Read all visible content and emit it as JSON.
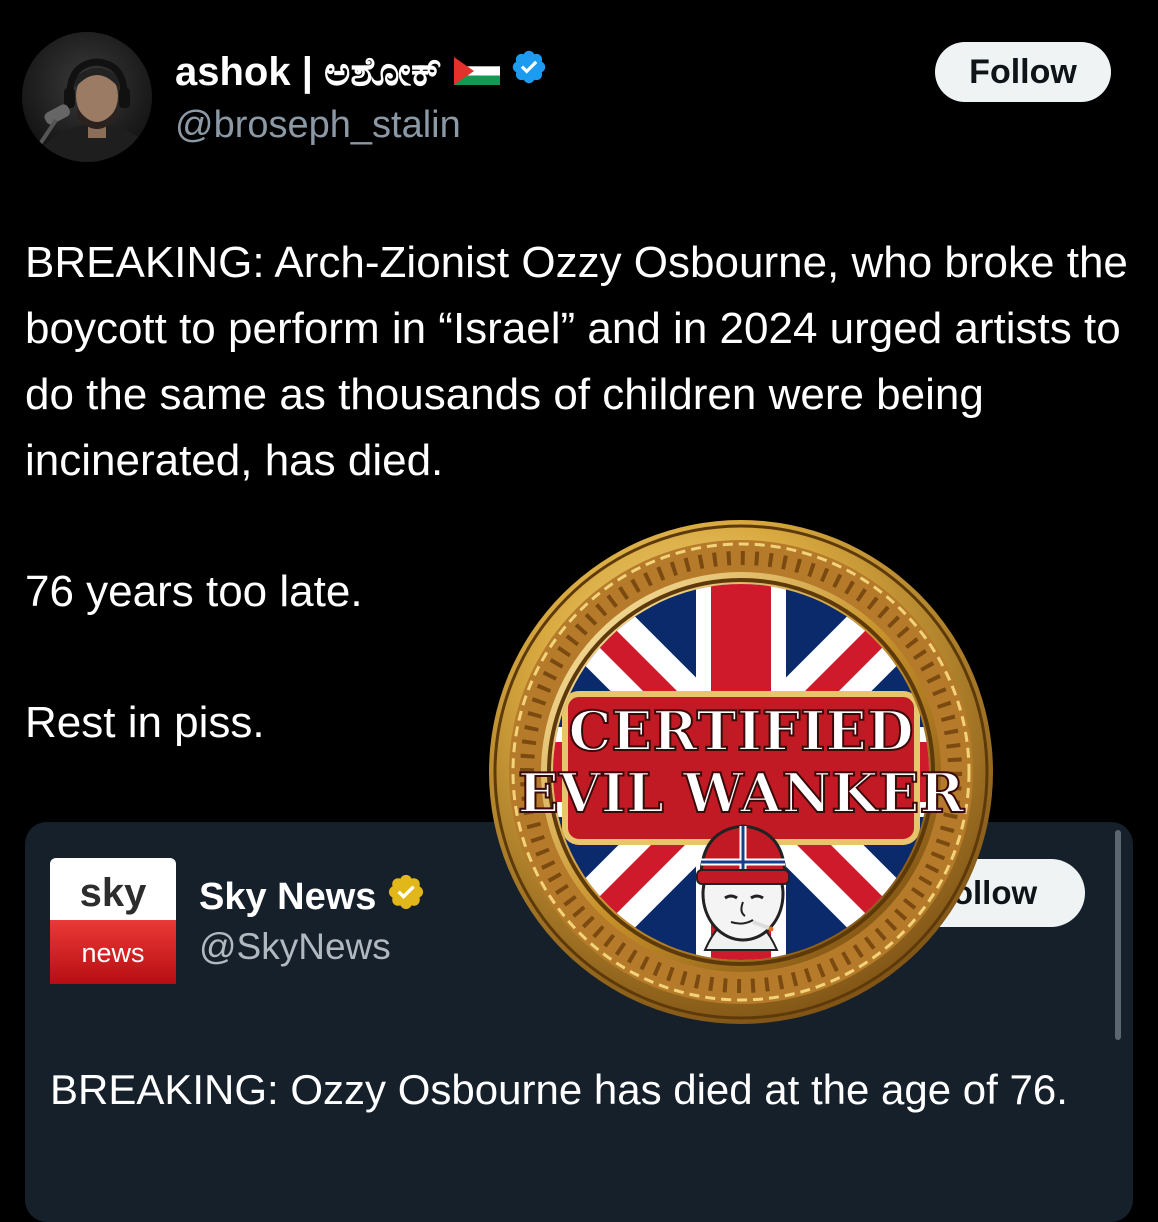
{
  "author": {
    "name": "ashok | ಅಶೋಕ್",
    "handle": "@broseph_stalin",
    "flag_icon": "palestine-flag-icon",
    "verified_color": "#1d9bf0",
    "follow_label": "Follow"
  },
  "tweet": {
    "paragraphs": [
      "BREAKING: Arch-Zionist Ozzy Osbourne, who broke the boycott to perform in “Israel” and in 2024 urged artists to do the same as thousands of children were being incinerated, has died.",
      "76 years too late.",
      "Rest in piss."
    ]
  },
  "quote": {
    "logo_top": "sky",
    "logo_bottom": "news",
    "name": "Sky News",
    "handle": "@SkyNews",
    "follow_label": "ollow",
    "verified_color": "#e2b719",
    "text": "BREAKING: Ozzy Osbourne has died at the age of 76."
  },
  "badge": {
    "line1": "CERTIFIED",
    "line2": "EVIL WANKER"
  }
}
